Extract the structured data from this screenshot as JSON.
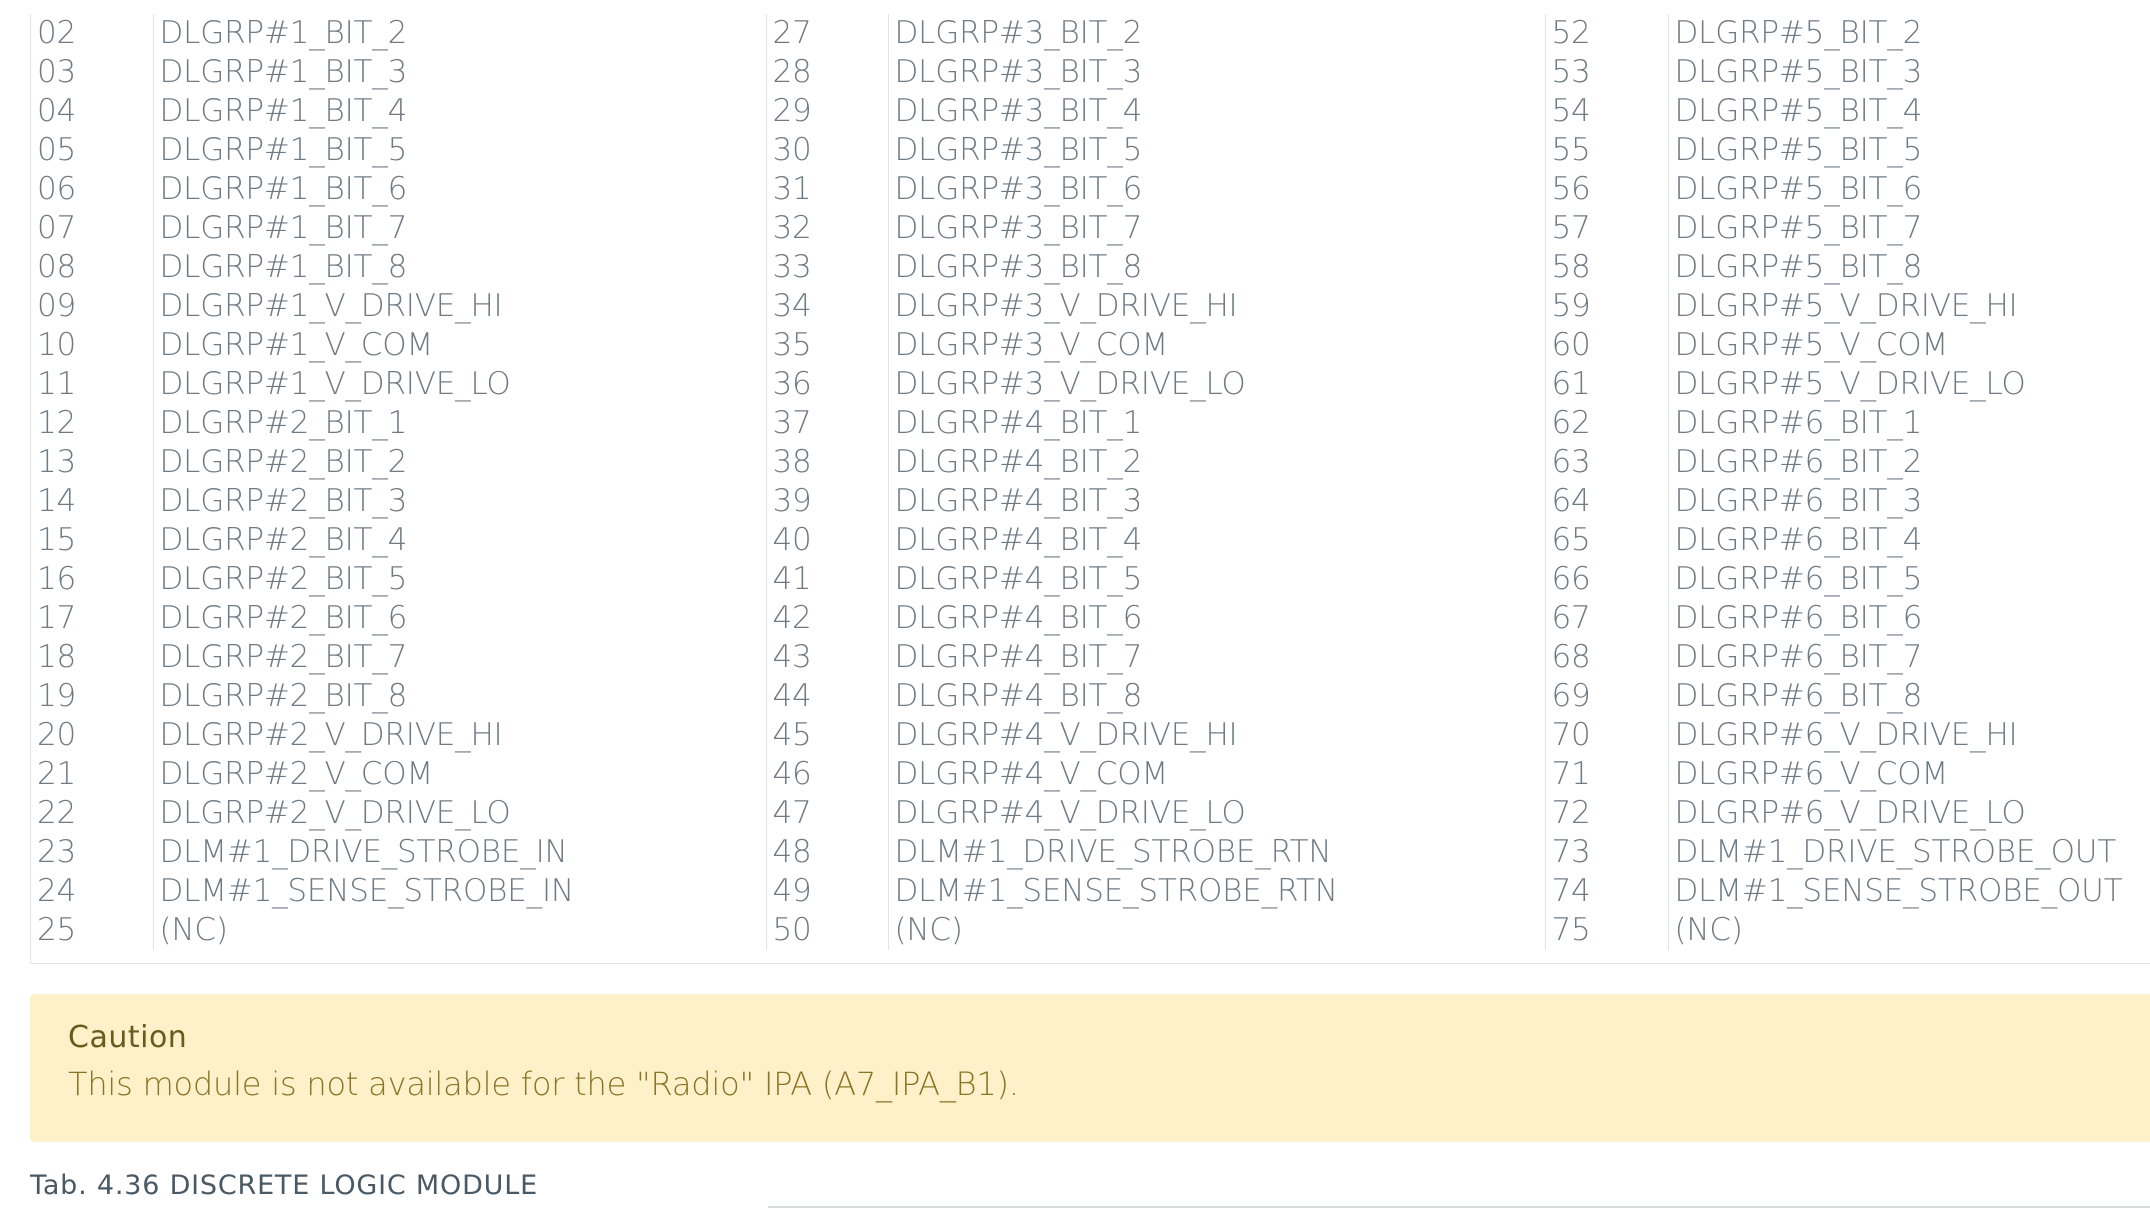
{
  "pin_table": {
    "rows": [
      [
        "02",
        "DLGRP#1_BIT_2",
        "27",
        "DLGRP#3_BIT_2",
        "52",
        "DLGRP#5_BIT_2"
      ],
      [
        "03",
        "DLGRP#1_BIT_3",
        "28",
        "DLGRP#3_BIT_3",
        "53",
        "DLGRP#5_BIT_3"
      ],
      [
        "04",
        "DLGRP#1_BIT_4",
        "29",
        "DLGRP#3_BIT_4",
        "54",
        "DLGRP#5_BIT_4"
      ],
      [
        "05",
        "DLGRP#1_BIT_5",
        "30",
        "DLGRP#3_BIT_5",
        "55",
        "DLGRP#5_BIT_5"
      ],
      [
        "06",
        "DLGRP#1_BIT_6",
        "31",
        "DLGRP#3_BIT_6",
        "56",
        "DLGRP#5_BIT_6"
      ],
      [
        "07",
        "DLGRP#1_BIT_7",
        "32",
        "DLGRP#3_BIT_7",
        "57",
        "DLGRP#5_BIT_7"
      ],
      [
        "08",
        "DLGRP#1_BIT_8",
        "33",
        "DLGRP#3_BIT_8",
        "58",
        "DLGRP#5_BIT_8"
      ],
      [
        "09",
        "DLGRP#1_V_DRIVE_HI",
        "34",
        "DLGRP#3_V_DRIVE_HI",
        "59",
        "DLGRP#5_V_DRIVE_HI"
      ],
      [
        "10",
        "DLGRP#1_V_COM",
        "35",
        "DLGRP#3_V_COM",
        "60",
        "DLGRP#5_V_COM"
      ],
      [
        "11",
        "DLGRP#1_V_DRIVE_LO",
        "36",
        "DLGRP#3_V_DRIVE_LO",
        "61",
        "DLGRP#5_V_DRIVE_LO"
      ],
      [
        "12",
        "DLGRP#2_BIT_1",
        "37",
        "DLGRP#4_BIT_1",
        "62",
        "DLGRP#6_BIT_1"
      ],
      [
        "13",
        "DLGRP#2_BIT_2",
        "38",
        "DLGRP#4_BIT_2",
        "63",
        "DLGRP#6_BIT_2"
      ],
      [
        "14",
        "DLGRP#2_BIT_3",
        "39",
        "DLGRP#4_BIT_3",
        "64",
        "DLGRP#6_BIT_3"
      ],
      [
        "15",
        "DLGRP#2_BIT_4",
        "40",
        "DLGRP#4_BIT_4",
        "65",
        "DLGRP#6_BIT_4"
      ],
      [
        "16",
        "DLGRP#2_BIT_5",
        "41",
        "DLGRP#4_BIT_5",
        "66",
        "DLGRP#6_BIT_5"
      ],
      [
        "17",
        "DLGRP#2_BIT_6",
        "42",
        "DLGRP#4_BIT_6",
        "67",
        "DLGRP#6_BIT_6"
      ],
      [
        "18",
        "DLGRP#2_BIT_7",
        "43",
        "DLGRP#4_BIT_7",
        "68",
        "DLGRP#6_BIT_7"
      ],
      [
        "19",
        "DLGRP#2_BIT_8",
        "44",
        "DLGRP#4_BIT_8",
        "69",
        "DLGRP#6_BIT_8"
      ],
      [
        "20",
        "DLGRP#2_V_DRIVE_HI",
        "45",
        "DLGRP#4_V_DRIVE_HI",
        "70",
        "DLGRP#6_V_DRIVE_HI"
      ],
      [
        "21",
        "DLGRP#2_V_COM",
        "46",
        "DLGRP#4_V_COM",
        "71",
        "DLGRP#6_V_COM"
      ],
      [
        "22",
        "DLGRP#2_V_DRIVE_LO",
        "47",
        "DLGRP#4_V_DRIVE_LO",
        "72",
        "DLGRP#6_V_DRIVE_LO"
      ],
      [
        "23",
        "DLM#1_DRIVE_STROBE_IN",
        "48",
        "DLM#1_DRIVE_STROBE_RTN",
        "73",
        "DLM#1_DRIVE_STROBE_OUT"
      ],
      [
        "24",
        "DLM#1_SENSE_STROBE_IN",
        "49",
        "DLM#1_SENSE_STROBE_RTN",
        "74",
        "DLM#1_SENSE_STROBE_OUT"
      ],
      [
        "25",
        "(NC)",
        "50",
        "(NC)",
        "75",
        "(NC)"
      ]
    ]
  },
  "caution": {
    "title": "Caution",
    "text": "This module is not available for the \"Radio\" IPA (A7_IPA_B1)."
  },
  "caption": {
    "text": "Tab. 4.36 DISCRETE LOGIC MODULE"
  }
}
